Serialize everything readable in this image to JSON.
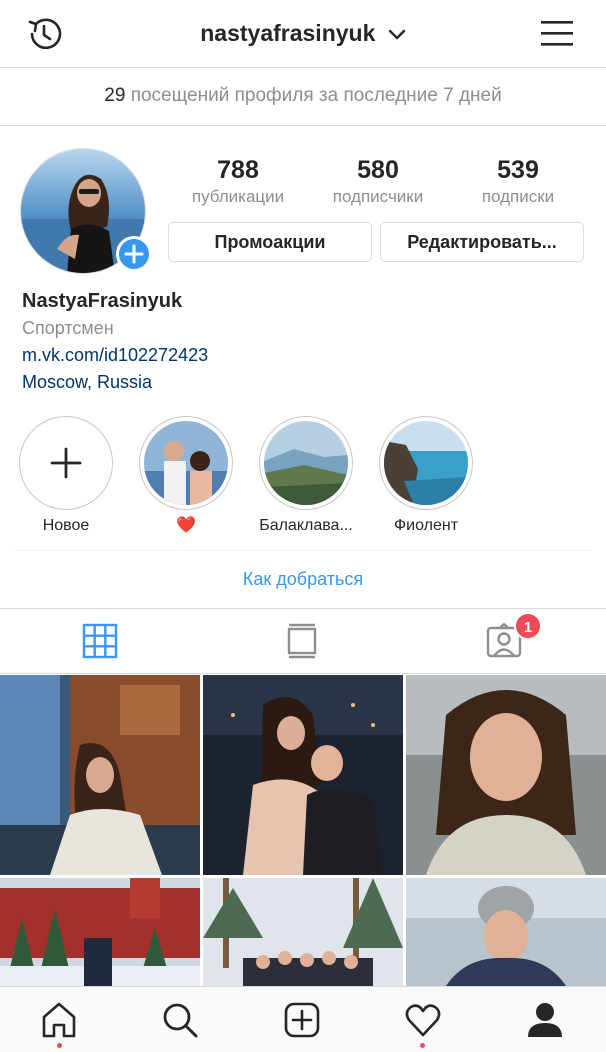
{
  "header": {
    "username": "nastyafrasinyuk"
  },
  "visits": {
    "count": "29",
    "text": "посещений профиля за последние 7 дней"
  },
  "stats": [
    {
      "value": "788",
      "label": "публикации"
    },
    {
      "value": "580",
      "label": "подписчики"
    },
    {
      "value": "539",
      "label": "подписки"
    }
  ],
  "buttons": {
    "promo": "Промоакции",
    "edit": "Редактировать..."
  },
  "bio": {
    "name": "NastyaFrasinyuk",
    "category": "Спортсмен",
    "link": "m.vk.com/id102272423",
    "location": "Moscow, Russia"
  },
  "highlights": [
    {
      "label": "Новое"
    },
    {
      "label": "❤️"
    },
    {
      "label": "Балаклава..."
    },
    {
      "label": "Фиолент"
    }
  ],
  "directions": "Как добраться",
  "tabs": {
    "tagged_badge": "1"
  },
  "colors": {
    "accent": "#3897f0",
    "link": "#003569",
    "notification": "#ed4956"
  }
}
